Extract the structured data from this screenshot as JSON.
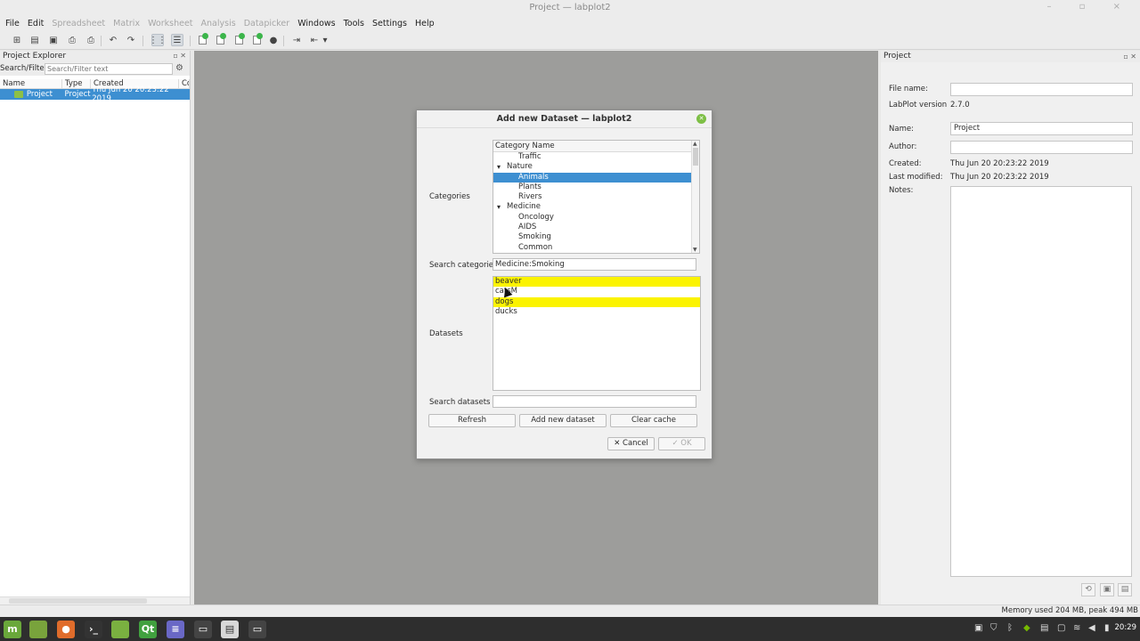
{
  "window": {
    "title": "Project — labplot2"
  },
  "menubar": [
    {
      "label": "File",
      "enabled": true
    },
    {
      "label": "Edit",
      "enabled": true
    },
    {
      "label": "Spreadsheet",
      "enabled": false
    },
    {
      "label": "Matrix",
      "enabled": false
    },
    {
      "label": "Worksheet",
      "enabled": false
    },
    {
      "label": "Analysis",
      "enabled": false
    },
    {
      "label": "Datapicker",
      "enabled": false
    },
    {
      "label": "Windows",
      "enabled": true
    },
    {
      "label": "Tools",
      "enabled": true
    },
    {
      "label": "Settings",
      "enabled": true
    },
    {
      "label": "Help",
      "enabled": true
    }
  ],
  "explorer": {
    "title": "Project Explorer",
    "search_label": "Search/Filter:",
    "search_placeholder": "Search/Filter text",
    "columns": [
      "Name",
      "Type",
      "Created",
      "Co"
    ],
    "rows": [
      {
        "name": "Project",
        "type": "Project",
        "created": "Thu Jun 20 20:23:22 2019"
      }
    ]
  },
  "properties": {
    "title": "Project",
    "file_name_label": "File name:",
    "file_name": "",
    "version_label": "LabPlot version",
    "version": "2.7.0",
    "name_label": "Name:",
    "name": "Project",
    "author_label": "Author:",
    "author": "",
    "created_label": "Created:",
    "created": "Thu Jun 20 20:23:22 2019",
    "modified_label": "Last modified:",
    "modified": "Thu Jun 20 20:23:22 2019",
    "notes_label": "Notes:"
  },
  "dialog": {
    "title": "Add new Dataset — labplot2",
    "categories_label": "Categories",
    "category_header": "Category Name",
    "categories": [
      {
        "label": "Traffic",
        "level": "child"
      },
      {
        "label": "Nature",
        "level": "parent"
      },
      {
        "label": "Animals",
        "level": "child",
        "selected": true
      },
      {
        "label": "Plants",
        "level": "child"
      },
      {
        "label": "Rivers",
        "level": "child"
      },
      {
        "label": "Medicine",
        "level": "parent"
      },
      {
        "label": "Oncology",
        "level": "child"
      },
      {
        "label": "AIDS",
        "level": "child"
      },
      {
        "label": "Smoking",
        "level": "child"
      },
      {
        "label": "Common",
        "level": "child"
      }
    ],
    "search_categories_label": "Search categories",
    "search_categories_value": "Medicine:Smoking",
    "datasets_label": "Datasets",
    "datasets": [
      {
        "label": "beaver",
        "highlighted": true
      },
      {
        "label": "catsM",
        "highlighted": false
      },
      {
        "label": "dogs",
        "highlighted": true
      },
      {
        "label": "ducks",
        "highlighted": false
      }
    ],
    "search_datasets_label": "Search datasets",
    "search_datasets_value": "",
    "refresh": "Refresh",
    "add": "Add new dataset",
    "clear": "Clear cache",
    "cancel": "✕ Cancel",
    "ok": "✓ OK"
  },
  "status": {
    "memory": "Memory used 204 MB, peak 494 MB"
  },
  "taskbar": {
    "clock": "20:29"
  },
  "colors": {
    "selection": "#3d8fd1",
    "highlight": "#fbf300",
    "workspace": "#9d9d9b"
  }
}
